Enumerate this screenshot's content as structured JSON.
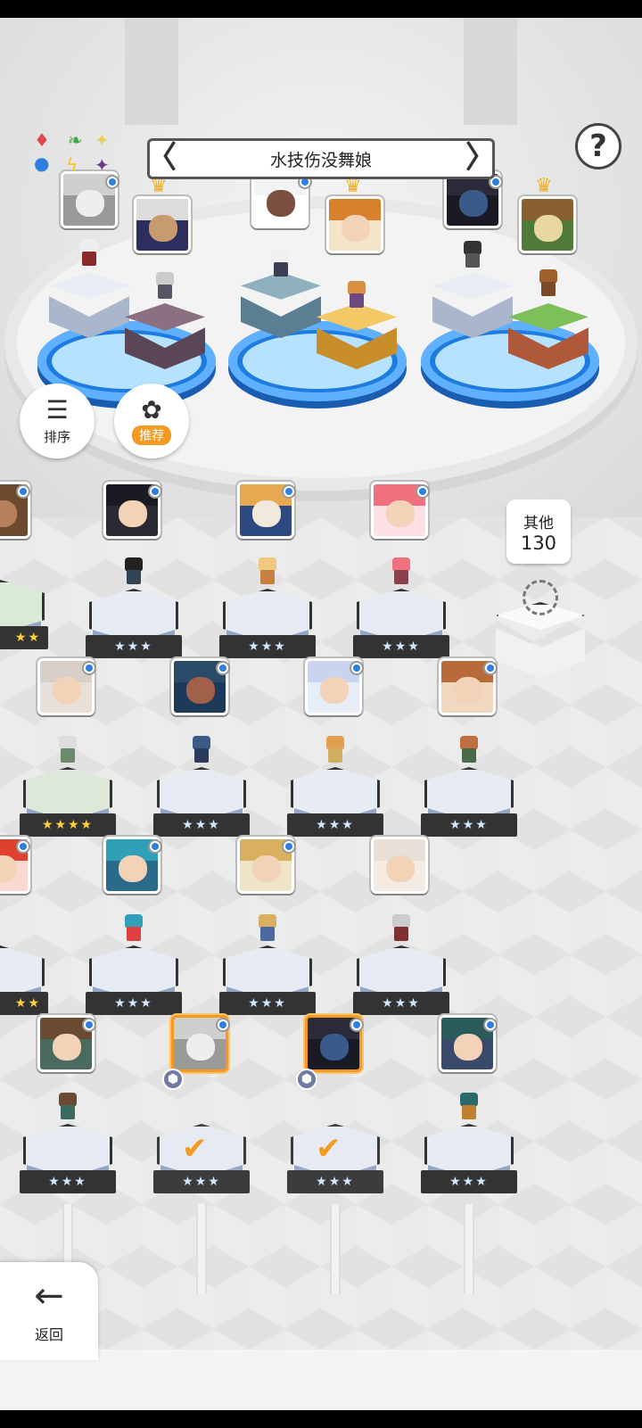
{
  "header": {
    "title": "水技伤没舞娘",
    "prev_arrow": "〈",
    "next_arrow": "〉",
    "help_label": "?",
    "element_icons": [
      "diamond-red",
      "leaf-green",
      "sparkle-yellow",
      "circle-blue",
      "bolt-yellow",
      "sparkle-purple"
    ]
  },
  "side_buttons": {
    "sort_label": "排序",
    "recommend_label": "推荐"
  },
  "other_bubble": {
    "label": "其他",
    "count": "130"
  },
  "stars": {
    "three": "★★★",
    "four": "★★★★",
    "two": "★★"
  },
  "footer": {
    "back_label": "返回"
  },
  "colors": {
    "accent_orange": "#f39a22",
    "pool_blue": "#1e7be0",
    "badge_blue": "#2e7fe0",
    "crown_gold": "#f0b020"
  }
}
